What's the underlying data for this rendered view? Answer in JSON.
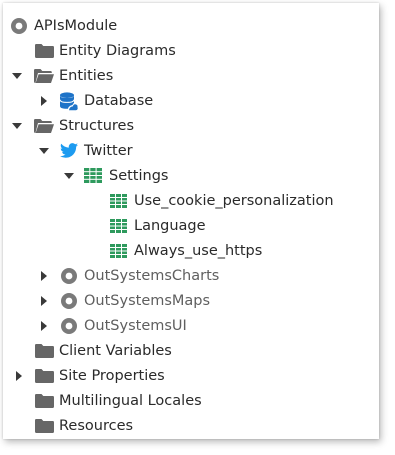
{
  "colors": {
    "folder": "#666666",
    "caret": "#3a3a3a",
    "module_icon": "#7a7a7a",
    "structure_icon": "#2e9a5d",
    "twitter_icon": "#1d9bf0",
    "database_icon": "#1e73c8",
    "text": "#2a2a2a",
    "muted_text": "#5f5f5f"
  },
  "tree": {
    "root": {
      "label": "APIsModule",
      "icon": "module-icon"
    },
    "entity_diagrams": {
      "label": "Entity Diagrams",
      "icon": "folder-icon"
    },
    "entities": {
      "label": "Entities",
      "icon": "folder-open-icon",
      "expanded": true
    },
    "database": {
      "label": "Database",
      "icon": "database-icon",
      "expanded": false
    },
    "structures": {
      "label": "Structures",
      "icon": "folder-open-icon",
      "expanded": true
    },
    "twitter": {
      "label": "Twitter",
      "icon": "twitter-icon",
      "expanded": true
    },
    "settings": {
      "label": "Settings",
      "icon": "structure-icon",
      "expanded": true
    },
    "attributes": [
      {
        "label": "Use_cookie_personalization",
        "icon": "attribute-icon"
      },
      {
        "label": "Language",
        "icon": "attribute-icon"
      },
      {
        "label": "Always_use_https",
        "icon": "attribute-icon"
      }
    ],
    "modules": [
      {
        "label": "OutSystemsCharts",
        "icon": "module-icon",
        "expanded": false
      },
      {
        "label": "OutSystemsMaps",
        "icon": "module-icon",
        "expanded": false
      },
      {
        "label": "OutSystemsUI",
        "icon": "module-icon",
        "expanded": false
      }
    ],
    "client_variables": {
      "label": "Client Variables",
      "icon": "folder-icon"
    },
    "site_properties": {
      "label": "Site Properties",
      "icon": "folder-icon",
      "expanded": false
    },
    "multilingual_locales": {
      "label": "Multilingual Locales",
      "icon": "folder-icon"
    },
    "resources": {
      "label": "Resources",
      "icon": "folder-icon"
    }
  }
}
